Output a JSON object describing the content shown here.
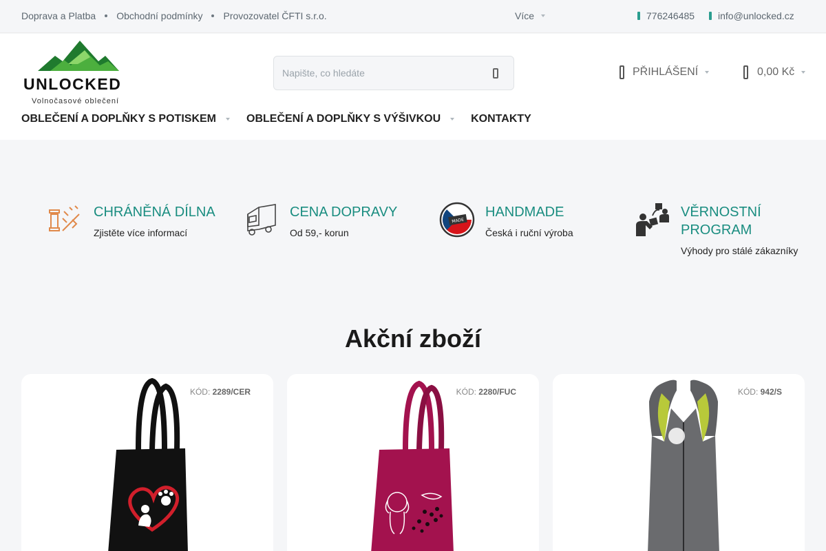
{
  "topbar": {
    "links": [
      "Doprava a Platba",
      "Obchodní podmínky",
      "Provozovatel ČFTI s.r.o."
    ],
    "more": "Více",
    "phone": "776246485",
    "email": "info@unlocked.cz",
    "phone_icon": "phone-icon",
    "email_icon": "envelope-icon"
  },
  "header": {
    "logo_text": "UNLOCKED",
    "logo_subtitle": "Volnočasové oblečení",
    "search_placeholder": "Napište, co hledáte",
    "login_label": "PŘIHLÁŠENÍ",
    "cart_label": "0,00 Kč"
  },
  "nav": {
    "items": [
      "OBLEČENÍ A DOPLŇKY S POTISKEM",
      "OBLEČENÍ A DOPLŇKY S VÝŠIVKOU",
      "KONTAKTY"
    ]
  },
  "benefits": [
    {
      "title": "CHRÁNĚNÁ DÍLNA",
      "desc": "Zjistěte více informací",
      "icon": "workshop-icon"
    },
    {
      "title": "CENA DOPRAVY",
      "desc": "Od 59,- korun",
      "icon": "truck-icon"
    },
    {
      "title": "HANDMADE",
      "desc": "Česká i ruční výroba",
      "icon": "czech-handmade-badge-icon"
    },
    {
      "title": "VĚRNOSTNÍ PROGRAM",
      "desc": "Výhody pro stálé zákazníky",
      "icon": "loyalty-icon"
    }
  ],
  "section_title": "Akční zboží",
  "products": [
    {
      "code_label": "KÓD:",
      "code": "2289/CER"
    },
    {
      "code_label": "KÓD:",
      "code": "2280/FUC"
    },
    {
      "code_label": "KÓD:",
      "code": "942/S"
    }
  ],
  "colors": {
    "accent": "#1a8d80",
    "logo_green": "#3a9b3a",
    "bag_black": "#111111",
    "bag_fuchsia": "#a3124e",
    "vest_grey": "#5f6063",
    "vest_lime": "#b8c93a"
  }
}
